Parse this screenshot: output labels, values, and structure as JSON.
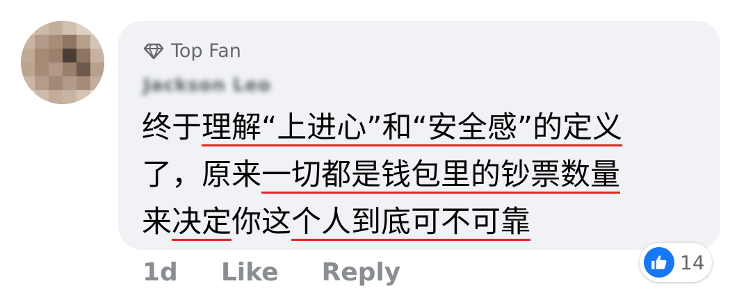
{
  "comment": {
    "badge": "Top Fan",
    "author": "Jackson Leo",
    "lines": [
      [
        "终于",
        "理解“上进心”和“安全感”的定义"
      ],
      [
        "了，原来",
        "一切都是钱包里的钞票数量"
      ],
      [
        "来",
        "决定",
        "你这",
        "个人到底可不可靠"
      ]
    ],
    "line1_a": "终于",
    "line1_b": "理解“上进心”和“安全感”的定义",
    "line2_a": "了，原来",
    "line2_b": "一切都是钱包里的钞票数量",
    "line3_a": "来",
    "line3_b": "决定",
    "line3_c": "你这",
    "line3_d": "个人到底可不可靠"
  },
  "actions": {
    "time": "1d",
    "like": "Like",
    "reply": "Reply"
  },
  "reactions": {
    "icon": "thumbs-up-icon",
    "count": "14",
    "color": "#1877f2"
  },
  "colors": {
    "bubble": "#f0f2f5",
    "underline": "#e02424"
  }
}
